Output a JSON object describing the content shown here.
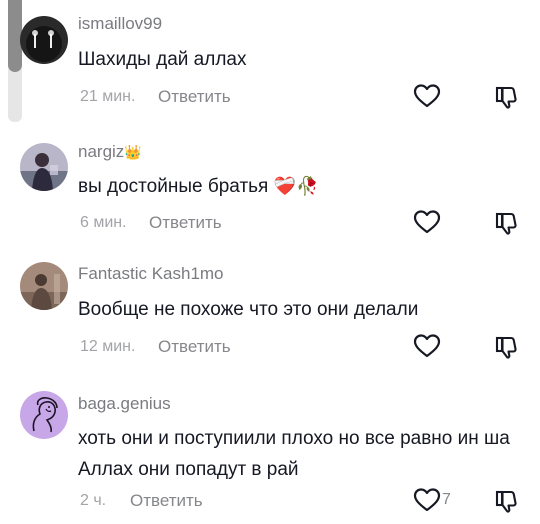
{
  "comments": [
    {
      "username": "ismaillov99",
      "text": "Шахиды дай аллах",
      "time": "21 мин.",
      "reply_label": "Ответить",
      "like_count": "",
      "avatar_icon": "avatar-dark-photo-icon"
    },
    {
      "username": "nargiz",
      "badge_emoji": "👑",
      "text": "вы достойные братья",
      "emojis": "❤️‍🩹🥀",
      "time": "6 мин.",
      "reply_label": "Ответить",
      "like_count": "",
      "avatar_icon": "avatar-person-photo-icon"
    },
    {
      "username": "Fantastic Kash1mo",
      "text": "Вообще не похоже что это они делали",
      "time": "12 мин.",
      "reply_label": "Ответить",
      "like_count": "",
      "avatar_icon": "avatar-brown-photo-icon"
    },
    {
      "username": "baga.genius",
      "text": "хоть они и поступиили плохо но все равно ин ша Аллах они попадут в рай",
      "time": "2 ч.",
      "reply_label": "Ответить",
      "like_count": "7",
      "avatar_icon": "avatar-purple-sketch-icon"
    }
  ],
  "colors": {
    "text": "#161823",
    "secondary": "#86878b",
    "purple_avatar": "#c8a7e8"
  }
}
